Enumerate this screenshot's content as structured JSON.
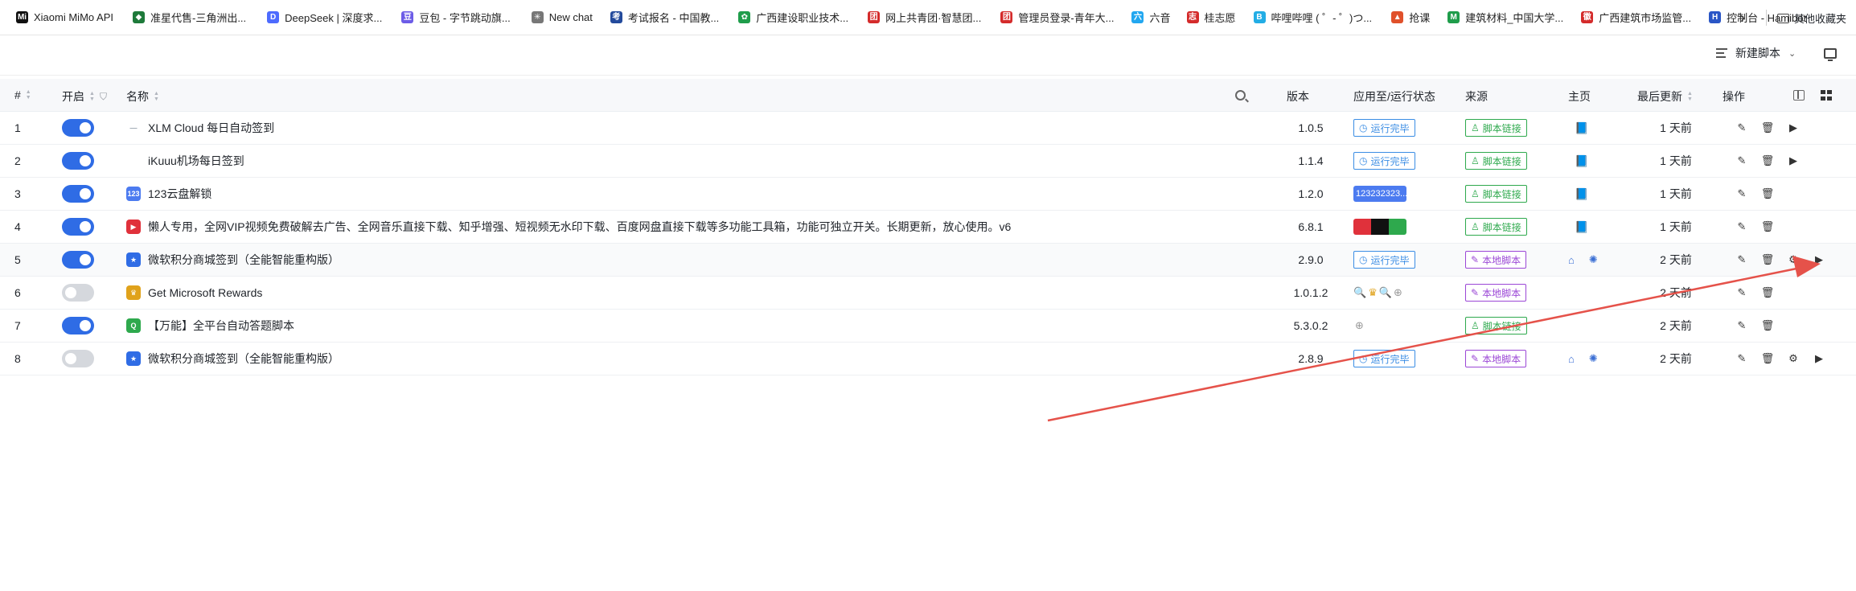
{
  "bookmarks": {
    "items": [
      {
        "label": "Xiaomi MiMo API",
        "icon": "xiaomi-icon",
        "color": "#111111",
        "glyph": "Mi"
      },
      {
        "label": "准星代售-三角洲出...",
        "icon": "crosshair-icon",
        "color": "#1e7a3a",
        "glyph": "◆"
      },
      {
        "label": "DeepSeek | 深度求...",
        "icon": "deepseek-whale-icon",
        "color": "#4d6bfe",
        "glyph": "D"
      },
      {
        "label": "豆包 - 字节跳动旗...",
        "icon": "doubao-icon",
        "color": "#6c5ce7",
        "glyph": "豆"
      },
      {
        "label": "New chat",
        "icon": "chat-icon",
        "color": "#777777",
        "glyph": "✳"
      },
      {
        "label": "考试报名 - 中国教...",
        "icon": "exam-icon",
        "color": "#234a9c",
        "glyph": "考"
      },
      {
        "label": "广西建设职业技术...",
        "icon": "college-icon",
        "color": "#1f9d4b",
        "glyph": "✿"
      },
      {
        "label": "网上共青团·智慧团...",
        "icon": "youth-league-icon",
        "color": "#d42b2b",
        "glyph": "团"
      },
      {
        "label": "管理员登录-青年大...",
        "icon": "youth-study-icon",
        "color": "#d42b2b",
        "glyph": "团"
      },
      {
        "label": "六音",
        "icon": "music-icon",
        "color": "#22a7f0",
        "glyph": "六"
      },
      {
        "label": "桂志愿",
        "icon": "volunteer-icon",
        "color": "#d42b2b",
        "glyph": "志"
      },
      {
        "label": "哔哩哔哩 ( ゜- ゜)つ...",
        "icon": "bilibili-icon",
        "color": "#23ade5",
        "glyph": "B"
      },
      {
        "label": "抢课",
        "icon": "course-icon",
        "color": "#e0512b",
        "glyph": "▲"
      },
      {
        "label": "建筑材料_中国大学...",
        "icon": "mooc-icon",
        "color": "#1f9d4b",
        "glyph": "M"
      },
      {
        "label": "广西建筑市场监管...",
        "icon": "market-icon",
        "color": "#d42b2b",
        "glyph": "徽"
      },
      {
        "label": "控制台 - Hamibot",
        "icon": "hamibot-icon",
        "color": "#2a56c6",
        "glyph": "H"
      }
    ],
    "more_icon": "chevron-right-icon",
    "other_label": "其他收藏夹"
  },
  "toolbar": {
    "new_script_label": "新建脚本"
  },
  "table": {
    "headers": {
      "index": "#",
      "enabled": "开启",
      "name": "名称",
      "version": "版本",
      "apply_status": "应用至/运行状态",
      "source": "来源",
      "homepage": "主页",
      "last_updated": "最后更新",
      "actions": "操作"
    },
    "rows": [
      {
        "index": "1",
        "enabled": true,
        "name": "XLM Cloud 每日自动签到",
        "icon": "cloud-icon",
        "icon_color": "#9aa5b1",
        "icon_glyph": "—",
        "version": "1.0.5",
        "status": "运行完毕",
        "status_kind": "blue",
        "source": "脚本链接",
        "source_kind": "green",
        "homepage": "book-icon",
        "updated": "1 天前",
        "actions": [
          "edit-icon",
          "delete-icon",
          "play-icon"
        ]
      },
      {
        "index": "2",
        "enabled": true,
        "name": "iKuuu机场每日签到",
        "icon": "blank-icon",
        "icon_color": "#ffffff",
        "icon_glyph": "",
        "version": "1.1.4",
        "status": "运行完毕",
        "status_kind": "blue",
        "source": "脚本链接",
        "source_kind": "green",
        "homepage": "book-icon",
        "updated": "1 天前",
        "actions": [
          "edit-icon",
          "delete-icon",
          "play-icon"
        ]
      },
      {
        "index": "3",
        "enabled": true,
        "name": "123云盘解锁",
        "icon": "123pan-icon",
        "icon_color": "#4c7bf0",
        "icon_glyph": "123",
        "version": "1.2.0",
        "status": "123232323...",
        "status_kind": "pan-strip",
        "source": "脚本链接",
        "source_kind": "green",
        "homepage": "book-icon",
        "updated": "1 天前",
        "actions": [
          "edit-icon",
          "delete-icon"
        ]
      },
      {
        "index": "4",
        "enabled": true,
        "name": "懒人专用，全网VIP视频免费破解去广告、全网音乐直接下载、知乎增强、短视频无水印下载、百度网盘直接下载等多功能工具箱，功能可独立开关。长期更新，放心使用。v6",
        "icon": "video-toolbox-icon",
        "icon_color": "#e0313b",
        "icon_glyph": "▶",
        "version": "6.8.1",
        "status": "site-icons",
        "status_kind": "video-strip",
        "source": "脚本链接",
        "source_kind": "green",
        "homepage": "book-icon",
        "updated": "1 天前",
        "actions": [
          "edit-icon",
          "delete-icon"
        ]
      },
      {
        "index": "5",
        "enabled": true,
        "name": "微软积分商城签到（全能智能重构版）",
        "icon": "medal-icon",
        "icon_color": "#2f6ce5",
        "icon_glyph": "★",
        "version": "2.9.0",
        "status": "运行完毕",
        "status_kind": "blue",
        "source": "本地脚本",
        "source_kind": "purple",
        "homepage": "home-icon",
        "updated": "2 天前",
        "actions": [
          "edit-icon",
          "delete-icon",
          "settings-icon",
          "play-icon"
        ]
      },
      {
        "index": "6",
        "enabled": false,
        "name": "Get Microsoft Rewards",
        "icon": "trophy-icon",
        "icon_color": "#e0a21b",
        "icon_glyph": "♛",
        "version": "1.0.1.2",
        "status": "search-icons",
        "status_kind": "icons",
        "source": "本地脚本",
        "source_kind": "purple",
        "homepage": "",
        "updated": "2 天前",
        "actions": [
          "edit-icon",
          "delete-icon"
        ]
      },
      {
        "index": "7",
        "enabled": true,
        "name": "【万能】全平台自动答题脚本",
        "icon": "answer-icon",
        "icon_color": "#2ea94d",
        "icon_glyph": "Q",
        "version": "5.3.0.2",
        "status": "globe-icon",
        "status_kind": "icons",
        "source": "脚本链接",
        "source_kind": "green",
        "homepage": "",
        "updated": "2 天前",
        "actions": [
          "edit-icon",
          "delete-icon"
        ]
      },
      {
        "index": "8",
        "enabled": false,
        "name": "微软积分商城签到（全能智能重构版）",
        "icon": "medal-icon",
        "icon_color": "#2f6ce5",
        "icon_glyph": "★",
        "version": "2.8.9",
        "status": "运行完毕",
        "status_kind": "blue",
        "source": "本地脚本",
        "source_kind": "purple",
        "homepage": "home-icon",
        "updated": "2 天前",
        "actions": [
          "edit-icon",
          "delete-icon",
          "settings-icon",
          "play-icon"
        ]
      }
    ]
  },
  "annotation": {
    "arrow_color": "#e5524a"
  }
}
